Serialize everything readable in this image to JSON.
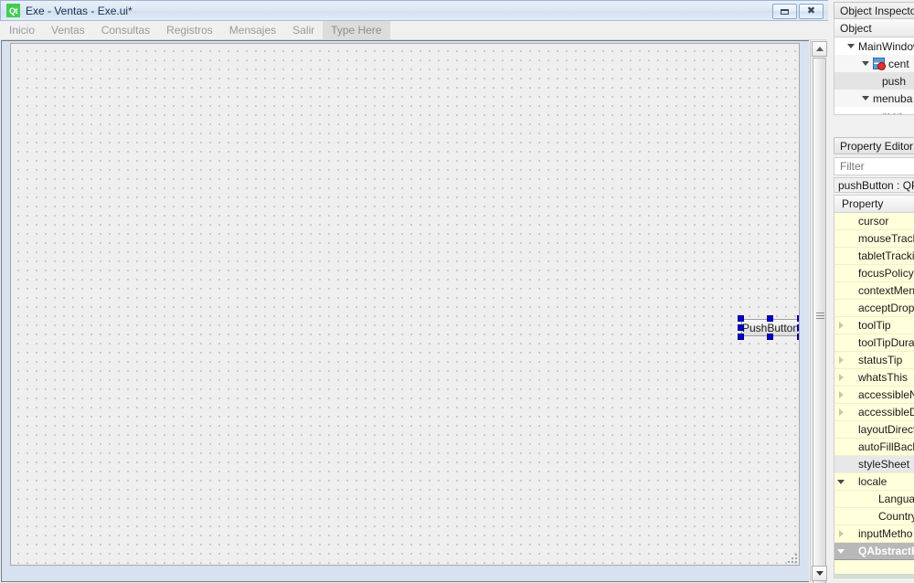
{
  "window": {
    "app_icon_text": "Qt",
    "title": "Exe - Ventas - Exe.ui*",
    "buttons": {
      "minimize": "minimize-restore",
      "close": "close"
    }
  },
  "menubar": {
    "items": [
      {
        "label": "Inicio"
      },
      {
        "label": "Ventas"
      },
      {
        "label": "Consultas"
      },
      {
        "label": "Registros"
      },
      {
        "label": "Mensajes"
      },
      {
        "label": "Salir"
      },
      {
        "label": "Type Here"
      }
    ]
  },
  "canvas": {
    "widget": {
      "label": "PushButton",
      "selected": true,
      "handles": 8
    }
  },
  "object_inspector": {
    "title": "Object Inspector",
    "column_header": "Object",
    "rows": [
      {
        "label": "MainWindow",
        "depth": 0,
        "expanded": true,
        "icon": "none",
        "selected": false
      },
      {
        "label": "cent",
        "depth": 1,
        "expanded": true,
        "icon": "central-widget-icon",
        "selected": false
      },
      {
        "label": "push",
        "depth": 2,
        "expanded": false,
        "icon": "none",
        "selected": true
      },
      {
        "label": "menuba",
        "depth": 1,
        "expanded": true,
        "icon": "none",
        "selected": false
      },
      {
        "label": "men",
        "depth": 2,
        "expanded": false,
        "icon": "none",
        "selected": false
      }
    ]
  },
  "property_editor": {
    "title": "Property Editor",
    "filter_placeholder": "Filter",
    "filter_value": "",
    "object_label": "pushButton : QPu",
    "column_header": "Property",
    "rows": [
      {
        "label": "cursor",
        "indent": 1,
        "tri": "none",
        "style": "normal"
      },
      {
        "label": "mouseTrack",
        "indent": 1,
        "tri": "none",
        "style": "normal"
      },
      {
        "label": "tabletTrackin",
        "indent": 1,
        "tri": "none",
        "style": "normal"
      },
      {
        "label": "focusPolicy",
        "indent": 1,
        "tri": "none",
        "style": "normal"
      },
      {
        "label": "contextMen",
        "indent": 1,
        "tri": "none",
        "style": "normal"
      },
      {
        "label": "acceptDrops",
        "indent": 1,
        "tri": "none",
        "style": "normal"
      },
      {
        "label": "toolTip",
        "indent": 1,
        "tri": "closed",
        "style": "normal"
      },
      {
        "label": "toolTipDura",
        "indent": 1,
        "tri": "none",
        "style": "normal"
      },
      {
        "label": "statusTip",
        "indent": 1,
        "tri": "closed",
        "style": "normal"
      },
      {
        "label": "whatsThis",
        "indent": 1,
        "tri": "closed",
        "style": "normal"
      },
      {
        "label": "accessibleNa",
        "indent": 1,
        "tri": "closed",
        "style": "normal"
      },
      {
        "label": "accessibleDe",
        "indent": 1,
        "tri": "closed",
        "style": "normal"
      },
      {
        "label": "layoutDirect",
        "indent": 1,
        "tri": "none",
        "style": "normal"
      },
      {
        "label": "autoFillBack",
        "indent": 1,
        "tri": "none",
        "style": "normal"
      },
      {
        "label": "styleSheet",
        "indent": 1,
        "tri": "none",
        "style": "shaded"
      },
      {
        "label": "locale",
        "indent": 1,
        "tri": "open",
        "style": "normal"
      },
      {
        "label": "Languag",
        "indent": 2,
        "tri": "none",
        "style": "normal"
      },
      {
        "label": "Country",
        "indent": 2,
        "tri": "none",
        "style": "normal"
      },
      {
        "label": "inputMetho",
        "indent": 1,
        "tri": "closed",
        "style": "normal"
      },
      {
        "label": "QAbstractB",
        "indent": 1,
        "tri": "open",
        "style": "group"
      }
    ]
  },
  "colors": {
    "property_row_bg": "#ffffdc",
    "selection_handle": "#0000c8",
    "qt_green": "#41cd52",
    "form_area_bg": "#d7e1ef"
  }
}
